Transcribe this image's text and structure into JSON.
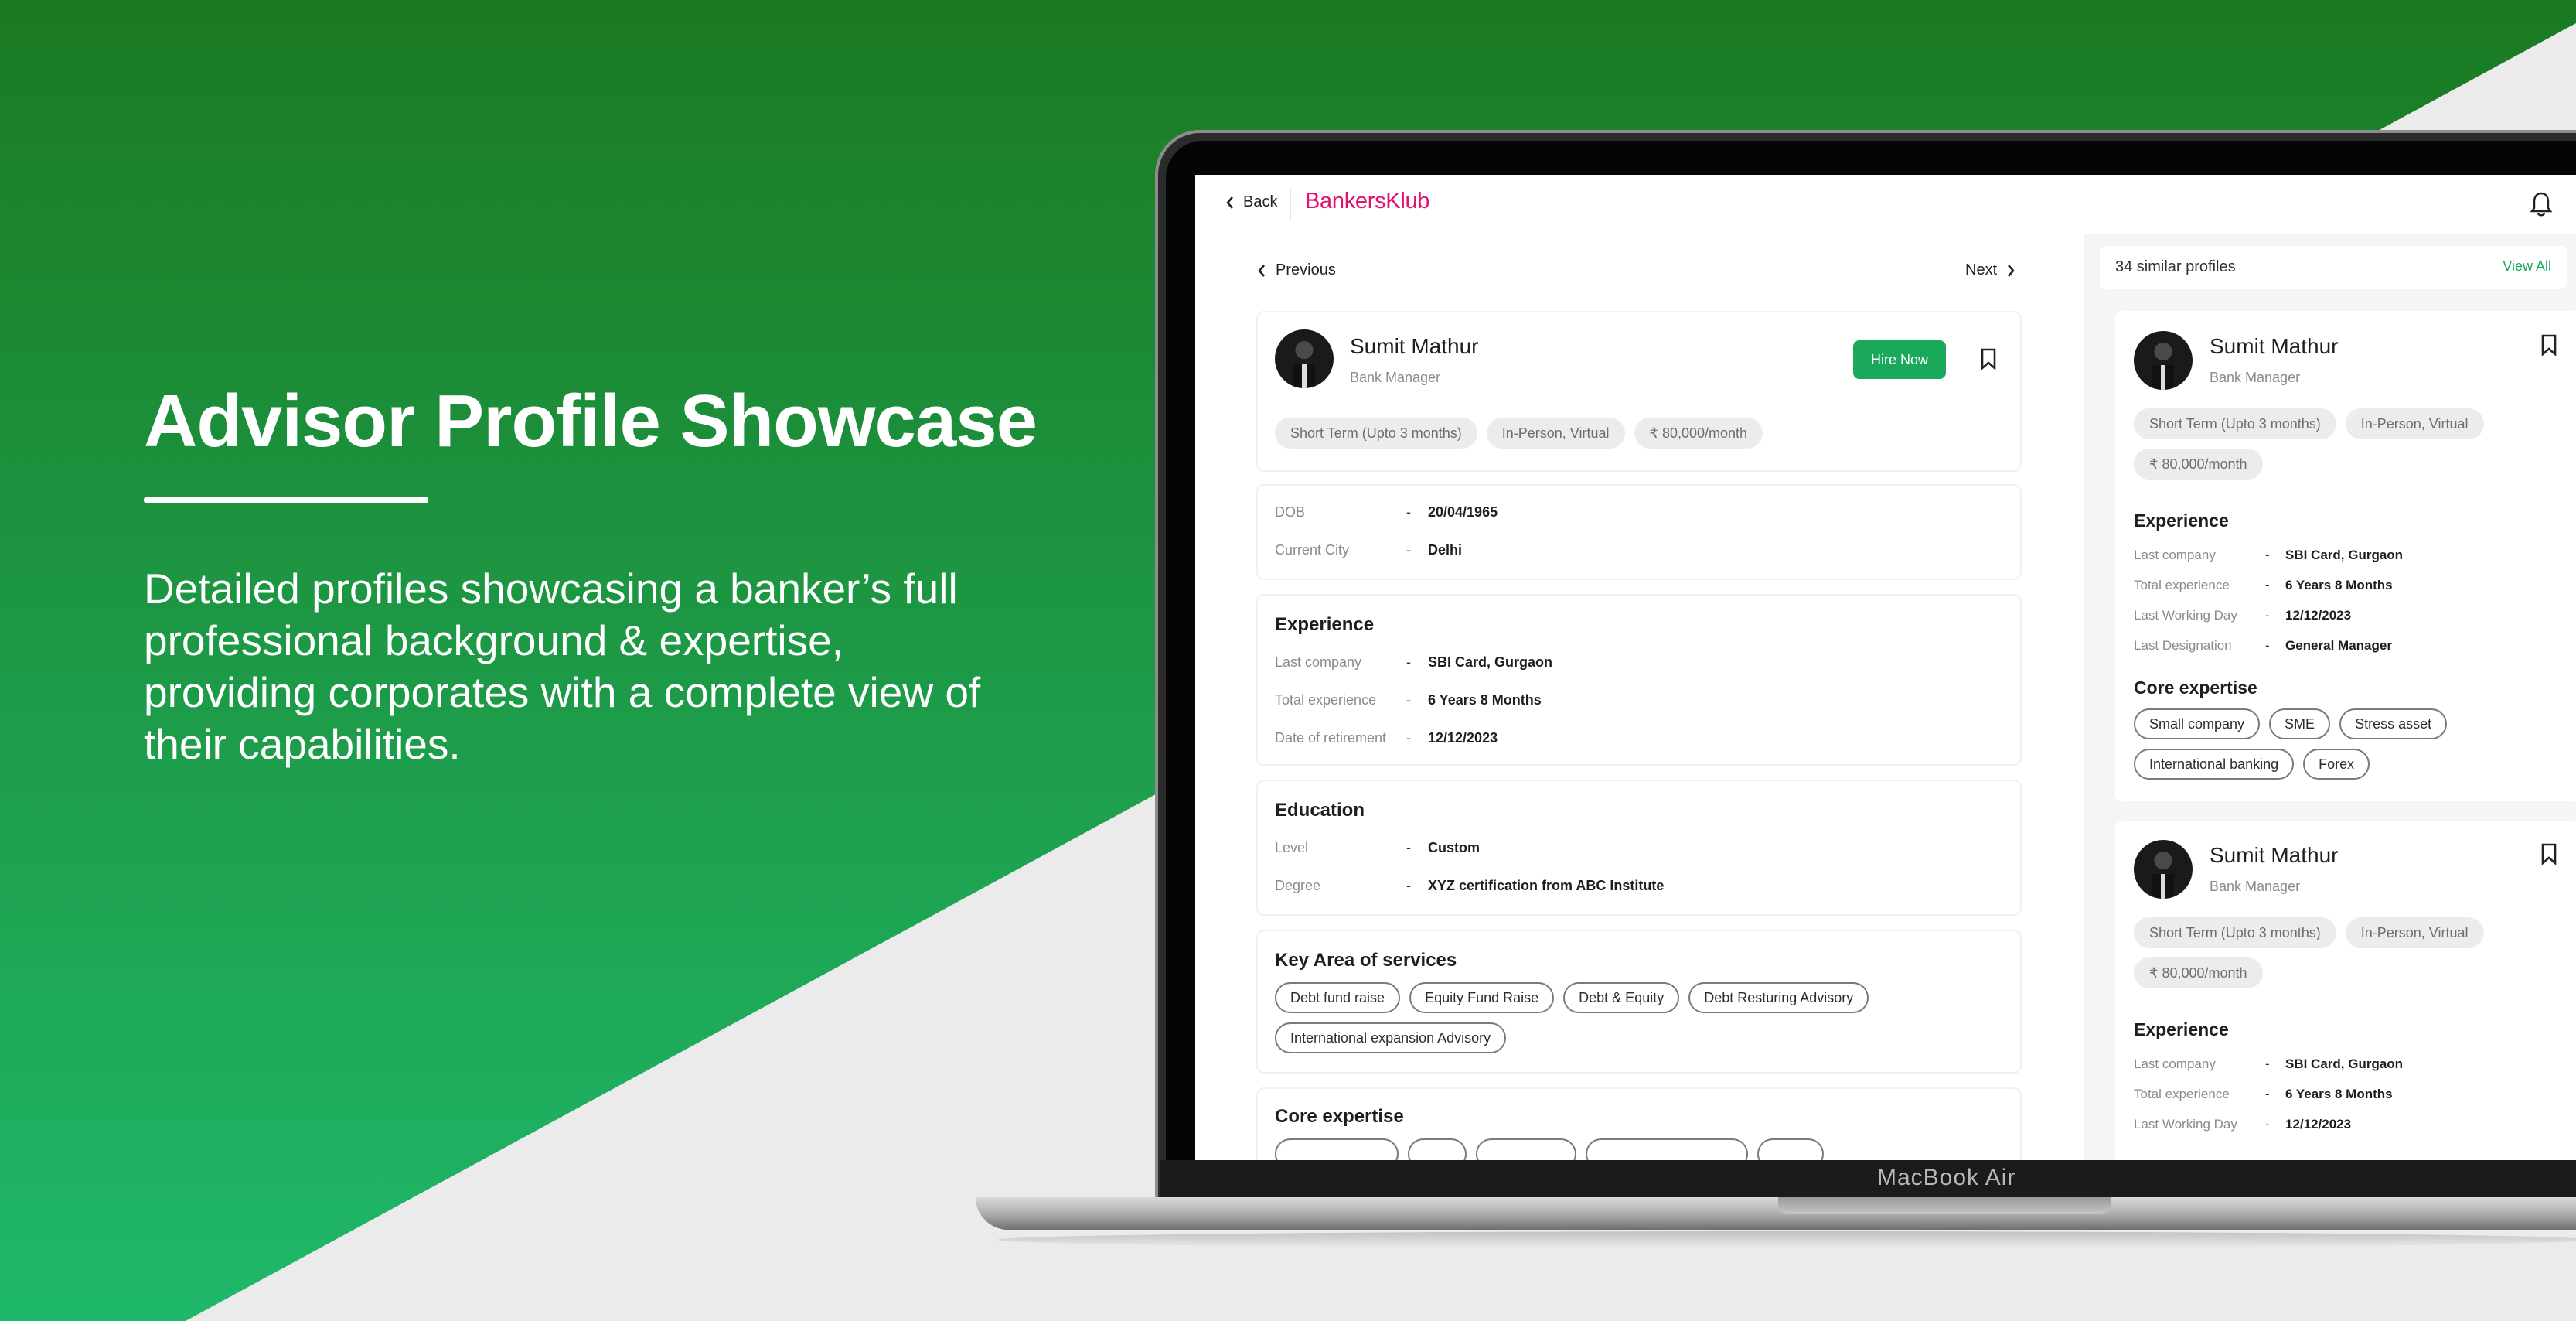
{
  "colors": {
    "accent": "#1aa85a",
    "brand": "#e2116e",
    "hero_green_top": "#1b7a22",
    "hero_green_bottom": "#1fb86a"
  },
  "hero": {
    "title": "Advisor Profile Showcase",
    "description": "Detailed profiles showcasing a banker’s full professional background & expertise, providing corporates with a complete view of their capabilities."
  },
  "device": {
    "label": "MacBook Air"
  },
  "app": {
    "back_label": "Back",
    "brand": "BankersKlub",
    "bell_icon": "bell-icon",
    "nav": {
      "previous": "Previous",
      "next": "Next"
    },
    "profile": {
      "name": "Sumit Mathur",
      "role": "Bank Manager",
      "hire_label": "Hire Now",
      "tags": [
        "Short Term (Upto 3 months)",
        "In-Person, Virtual",
        "₹ 80,000/month"
      ]
    },
    "personal": [
      {
        "key": "DOB",
        "sep": "-",
        "value": "20/04/1965"
      },
      {
        "key": "Current City",
        "sep": "-",
        "value": "Delhi"
      }
    ],
    "experience": {
      "title": "Experience",
      "rows": [
        {
          "key": "Last company",
          "sep": "-",
          "value": "SBI Card, Gurgaon"
        },
        {
          "key": "Total experience",
          "sep": "-",
          "value": "6 Years 8 Months"
        },
        {
          "key": "Date of retirement",
          "sep": "-",
          "value": "12/12/2023"
        }
      ]
    },
    "education": {
      "title": "Education",
      "rows": [
        {
          "key": "Level",
          "sep": "-",
          "value": "Custom"
        },
        {
          "key": "Degree",
          "sep": "-",
          "value": "XYZ certification from ABC Institute"
        }
      ]
    },
    "services": {
      "title": "Key Area of services",
      "items": [
        "Debt fund raise",
        "Equity Fund Raise",
        "Debt & Equity",
        "Debt Resturing Advisory",
        "International expansion Advisory"
      ]
    },
    "core": {
      "title": "Core expertise"
    },
    "similar": {
      "count_label": "34 similar profiles",
      "view_all": "View All",
      "cards": [
        {
          "name": "Sumit Mathur",
          "role": "Bank Manager",
          "tags": [
            "Short Term (Upto 3 months)",
            "In-Person, Virtual",
            "₹ 80,000/month"
          ],
          "exp_title": "Experience",
          "rows": [
            {
              "key": "Last company",
              "sep": "-",
              "value": "SBI Card, Gurgaon"
            },
            {
              "key": "Total experience",
              "sep": "-",
              "value": "6 Years 8 Months"
            },
            {
              "key": "Last Working Day",
              "sep": "-",
              "value": "12/12/2023"
            },
            {
              "key": "Last Designation",
              "sep": "-",
              "value": "General Manager"
            }
          ],
          "core_title": "Core expertise",
          "core": [
            "Small company",
            "SME",
            "Stress asset",
            "International banking",
            "Forex"
          ]
        },
        {
          "name": "Sumit Mathur",
          "role": "Bank Manager",
          "tags": [
            "Short Term (Upto 3 months)",
            "In-Person, Virtual",
            "₹ 80,000/month"
          ],
          "exp_title": "Experience",
          "rows": [
            {
              "key": "Last company",
              "sep": "-",
              "value": "SBI Card, Gurgaon"
            },
            {
              "key": "Total experience",
              "sep": "-",
              "value": "6 Years 8 Months"
            },
            {
              "key": "Last Working Day",
              "sep": "-",
              "value": "12/12/2023"
            }
          ]
        }
      ]
    }
  }
}
